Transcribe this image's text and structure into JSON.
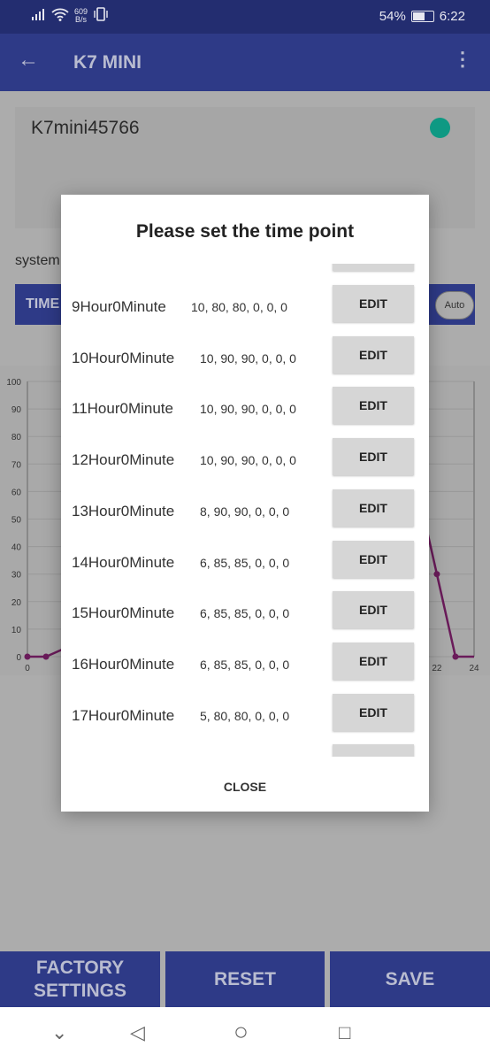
{
  "status_bar": {
    "net_speed_value": "609",
    "net_speed_unit": "B/s",
    "battery": "54%",
    "battery_level": 54,
    "time": "6:22"
  },
  "app_bar": {
    "title": "K7 MINI",
    "back_icon": "arrow-left-icon",
    "menu_icon": "more-vert-icon"
  },
  "device": {
    "name": "K7mini45766",
    "status_color": "#0e9983"
  },
  "system_label": "system",
  "mode_bar": {
    "label": "TIME",
    "toggle_label": "Auto"
  },
  "chart_data": {
    "type": "line",
    "y_ticks": [
      "0",
      "10",
      "20",
      "30",
      "40",
      "50",
      "60",
      "70",
      "80",
      "90",
      "100"
    ],
    "x_ticks_visible": [
      "0",
      "22",
      "24"
    ],
    "ylim": [
      0,
      100
    ],
    "xlim": [
      0,
      24
    ],
    "grid": true,
    "series": [
      {
        "color": "#6a1b5a",
        "points": [
          [
            0,
            0
          ],
          [
            1,
            0
          ],
          [
            21,
            60
          ],
          [
            22,
            30
          ],
          [
            23,
            0
          ],
          [
            24,
            0
          ]
        ]
      }
    ]
  },
  "dialog": {
    "title": "Please set the time point",
    "rows": [
      {
        "time": "9Hour0Minute",
        "values": "10, 80, 80, 0, 0, 0",
        "button": "EDIT"
      },
      {
        "time": "10Hour0Minute",
        "values": "10, 90, 90, 0, 0, 0",
        "button": "EDIT"
      },
      {
        "time": "11Hour0Minute",
        "values": "10, 90, 90, 0, 0, 0",
        "button": "EDIT"
      },
      {
        "time": "12Hour0Minute",
        "values": "10, 90, 90, 0, 0, 0",
        "button": "EDIT"
      },
      {
        "time": "13Hour0Minute",
        "values": "8, 90, 90, 0, 0, 0",
        "button": "EDIT"
      },
      {
        "time": "14Hour0Minute",
        "values": "6, 85, 85, 0, 0, 0",
        "button": "EDIT"
      },
      {
        "time": "15Hour0Minute",
        "values": "6, 85, 85, 0, 0, 0",
        "button": "EDIT"
      },
      {
        "time": "16Hour0Minute",
        "values": "6, 85, 85, 0, 0, 0",
        "button": "EDIT"
      },
      {
        "time": "17Hour0Minute",
        "values": "5, 80, 80, 0, 0, 0",
        "button": "EDIT"
      }
    ],
    "close_label": "CLOSE"
  },
  "bottom_buttons": {
    "factory": "FACTORY SETTINGS",
    "reset": "RESET",
    "save": "SAVE"
  },
  "nav_bar": {
    "down": "⌄",
    "back": "◁",
    "home": "○",
    "recent": "□"
  }
}
